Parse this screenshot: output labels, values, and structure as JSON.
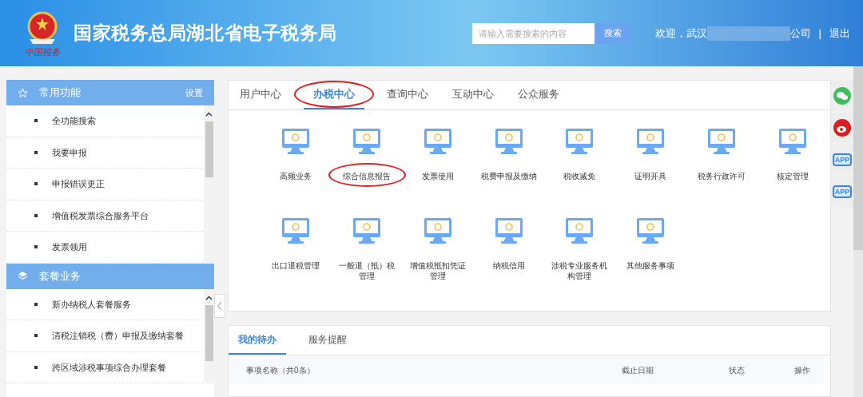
{
  "header": {
    "title": "国家税务总局湖北省电子税务局",
    "logo_caption": "中国税务",
    "search": {
      "placeholder": "请输入需要搜索的内容",
      "button": "搜索"
    },
    "welcome": "欢迎，武汉",
    "company_suffix": "公司",
    "separator": "|",
    "logout": "退出"
  },
  "sidebar": [
    {
      "kind": "star",
      "title": "常用功能",
      "action": "设置",
      "items": [
        "全功能搜索",
        "我要申报",
        "申报错误更正",
        "增值税发票综合服务平台",
        "发票领用"
      ]
    },
    {
      "kind": "layers",
      "title": "套餐业务",
      "items": [
        "新办纳税人套餐服务",
        "清税注销税（费）申报及缴纳套餐",
        "跨区域涉税事项综合办理套餐"
      ]
    }
  ],
  "tabs": [
    {
      "label": "用户中心",
      "selected": false,
      "circled": false
    },
    {
      "label": "办税中心",
      "selected": true,
      "circled": true
    },
    {
      "label": "查询中心",
      "selected": false,
      "circled": false
    },
    {
      "label": "互动中心",
      "selected": false,
      "circled": false
    },
    {
      "label": "公众服务",
      "selected": false,
      "circled": false
    }
  ],
  "services": [
    {
      "label": "高频业务",
      "circled": false
    },
    {
      "label": "综合信息报告",
      "circled": true
    },
    {
      "label": "发票使用",
      "circled": false
    },
    {
      "label": "税费申报及缴纳",
      "circled": false
    },
    {
      "label": "税收减免",
      "circled": false
    },
    {
      "label": "证明开具",
      "circled": false
    },
    {
      "label": "税务行政许可",
      "circled": false
    },
    {
      "label": "核定管理",
      "circled": false
    },
    {
      "label": "出口退税管理",
      "circled": false
    },
    {
      "label": "一般退（抵）税管理",
      "circled": false
    },
    {
      "label": "增值税抵扣凭证管理",
      "circled": false
    },
    {
      "label": "纳税信用",
      "circled": false
    },
    {
      "label": "涉税专业服务机构管理",
      "circled": false
    },
    {
      "label": "其他服务事项",
      "circled": false
    }
  ],
  "side_buttons": [
    {
      "kind": "wechat"
    },
    {
      "kind": "weibo"
    },
    {
      "kind": "app",
      "label": "APP"
    },
    {
      "kind": "app",
      "label": "APP"
    }
  ],
  "todo": {
    "tabs": [
      {
        "label": "我的待办",
        "selected": true
      },
      {
        "label": "服务提醒",
        "selected": false
      }
    ],
    "columns": [
      "事项名称（共0条）",
      "截止日期",
      "状态",
      "操作"
    ]
  }
}
